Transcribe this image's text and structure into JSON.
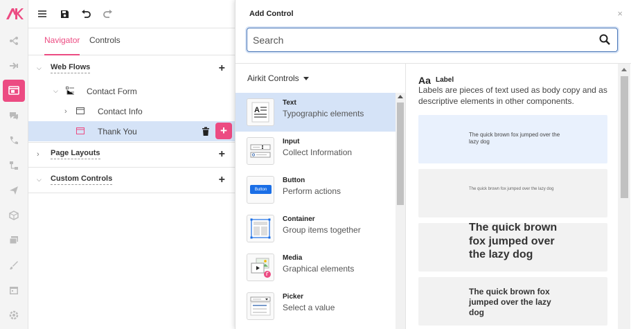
{
  "toolbar": {
    "menu_icon": "hamburger-icon",
    "save_icon": "save-icon",
    "undo_icon": "undo-icon",
    "redo_icon": "redo-icon"
  },
  "tabs": [
    {
      "label": "Navigator",
      "active": true
    },
    {
      "label": "Controls",
      "active": false
    }
  ],
  "navigator": {
    "web_flows": "Web Flows",
    "contact_form": "Contact Form",
    "contact_info": "Contact Info",
    "thank_you": "Thank You",
    "page_layouts": "Page Layouts",
    "custom_controls": "Custom Controls"
  },
  "modal": {
    "title": "Add Control",
    "close": "×",
    "search_placeholder": "Search",
    "controls_dropdown": "Airkit Controls",
    "items": [
      {
        "title": "Text",
        "desc": "Typographic elements"
      },
      {
        "title": "Input",
        "desc": "Collect Information"
      },
      {
        "title": "Button",
        "desc": "Perform actions",
        "thumb_text": "Button"
      },
      {
        "title": "Container",
        "desc": "Group items together"
      },
      {
        "title": "Media",
        "desc": "Graphical elements"
      },
      {
        "title": "Picker",
        "desc": "Select a value"
      }
    ],
    "preview": {
      "aa": "Aa",
      "name": "Label",
      "description": "Labels are pieces of text used as body copy and as descriptive elements in other components.",
      "samples": [
        "The quick brown fox jumped over the lazy dog",
        "The quick brown fox jumped over the lazy dog",
        "The quick brown fox jumped over the lazy dog",
        "The quick brown fox jumped over the lazy dog"
      ]
    }
  },
  "colors": {
    "accent": "#ec4b82",
    "selected_row": "#d5e3f7",
    "search_border": "#4b78b8"
  }
}
